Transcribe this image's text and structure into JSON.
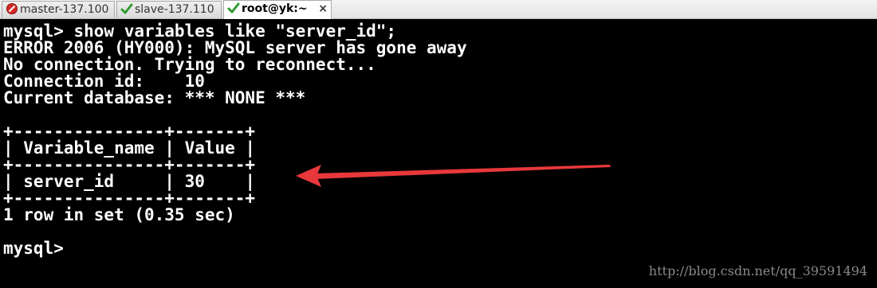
{
  "tabs": [
    {
      "label": "master-137.100",
      "icon": "red-stop-icon",
      "active": false
    },
    {
      "label": "slave-137.110",
      "icon": "green-check-icon",
      "active": false
    },
    {
      "label": "root@yk:~",
      "icon": "green-check-icon",
      "active": true,
      "close": "×"
    }
  ],
  "terminal": {
    "lines": [
      "mysql> show variables like \"server_id\";",
      "ERROR 2006 (HY000): MySQL server has gone away",
      "No connection. Trying to reconnect...",
      "Connection id:    10",
      "Current database: *** NONE ***",
      "",
      "+---------------+-------+",
      "| Variable_name | Value |",
      "+---------------+-------+",
      "| server_id     | 30    |",
      "+---------------+-------+",
      "1 row in set (0.35 sec)",
      "",
      "mysql>"
    ]
  },
  "annotation": {
    "arrow_color": "#e8383b"
  },
  "watermark": "http://blog.csdn.net/qq_39591494",
  "colors": {
    "background": "#000000",
    "text": "#ffffff"
  }
}
